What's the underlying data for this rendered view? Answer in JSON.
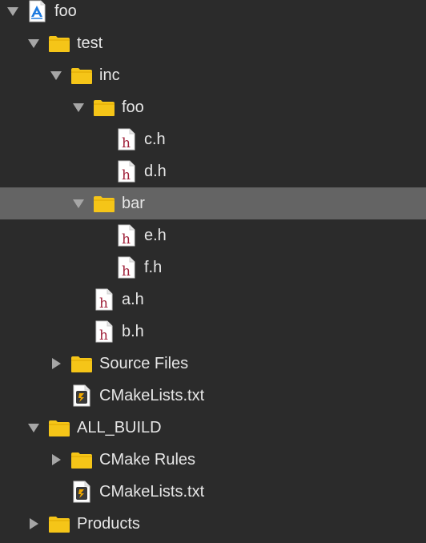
{
  "tree": {
    "rows": [
      {
        "label": "foo",
        "kind": "project",
        "disclosure": "expanded",
        "selected": false
      },
      {
        "label": "test",
        "kind": "folder",
        "disclosure": "expanded",
        "selected": false
      },
      {
        "label": "inc",
        "kind": "folder",
        "disclosure": "expanded",
        "selected": false
      },
      {
        "label": "foo",
        "kind": "folder",
        "disclosure": "expanded",
        "selected": false
      },
      {
        "label": "c.h",
        "kind": "header-file",
        "disclosure": "none",
        "selected": false
      },
      {
        "label": "d.h",
        "kind": "header-file",
        "disclosure": "none",
        "selected": false
      },
      {
        "label": "bar",
        "kind": "folder",
        "disclosure": "expanded",
        "selected": true
      },
      {
        "label": "e.h",
        "kind": "header-file",
        "disclosure": "none",
        "selected": false
      },
      {
        "label": "f.h",
        "kind": "header-file",
        "disclosure": "none",
        "selected": false
      },
      {
        "label": "a.h",
        "kind": "header-file",
        "disclosure": "none",
        "selected": false
      },
      {
        "label": "b.h",
        "kind": "header-file",
        "disclosure": "none",
        "selected": false
      },
      {
        "label": "Source Files",
        "kind": "folder",
        "disclosure": "collapsed",
        "selected": false
      },
      {
        "label": "CMakeLists.txt",
        "kind": "cmake-file",
        "disclosure": "none",
        "selected": false
      },
      {
        "label": "ALL_BUILD",
        "kind": "folder",
        "disclosure": "expanded",
        "selected": false
      },
      {
        "label": "CMake Rules",
        "kind": "folder",
        "disclosure": "collapsed",
        "selected": false
      },
      {
        "label": "CMakeLists.txt",
        "kind": "cmake-file",
        "disclosure": "none",
        "selected": false
      },
      {
        "label": "Products",
        "kind": "folder",
        "disclosure": "collapsed",
        "selected": false
      }
    ]
  },
  "icons": {
    "project": "xcode-project-icon",
    "folder": "folder-icon",
    "header-file": "header-file-icon",
    "cmake-file": "cmake-file-icon",
    "expanded": "disclosure-expanded-icon",
    "collapsed": "disclosure-collapsed-icon"
  },
  "colors": {
    "background": "#2b2b2b",
    "selection": "#646464",
    "text": "#e6e6e6",
    "folder": "#f5c518",
    "header_letter": "#a0213a"
  }
}
